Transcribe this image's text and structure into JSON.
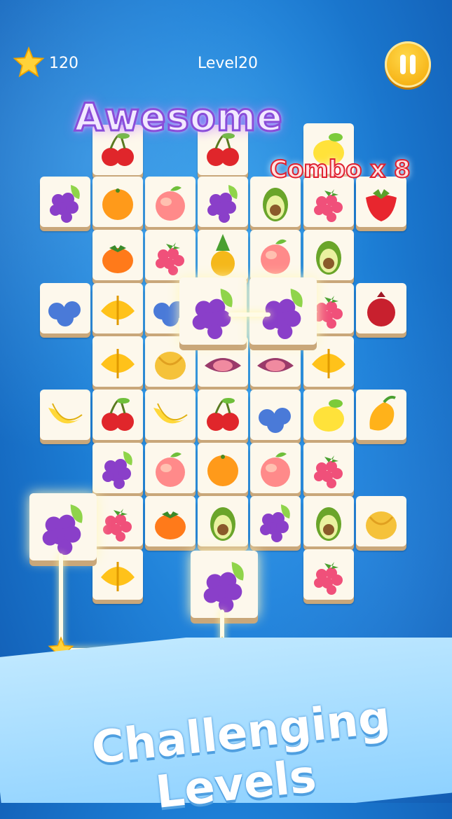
{
  "hud": {
    "stars": "120",
    "level": "Level20",
    "star_icon": "star-icon",
    "pause_icon": "pause-icon"
  },
  "effects": {
    "praise": "Awesome",
    "combo": "Combo x 8"
  },
  "banner": {
    "line1": "Challenging",
    "line2": "Levels"
  },
  "colors": {
    "accent": "#f3a400",
    "tile": "#fdf8ec",
    "tile_edge": "#c9a77a",
    "background": "#1d7fd6"
  },
  "board": {
    "tiles": [
      "cherries",
      "cherries",
      "lemon",
      "grapes",
      "orange",
      "peach",
      "grapes",
      "avocado",
      "raspberry",
      "strawberry",
      "persimmon",
      "raspberry",
      "pineapple",
      "peach",
      "avocado",
      "blueberries",
      "starfruit",
      "blueberries",
      "raspberry",
      "pomegranate",
      "starfruit",
      "melon",
      "fig",
      "fig",
      "starfruit",
      "banana",
      "cherries",
      "banana",
      "cherries",
      "blueberries",
      "lemon",
      "mango",
      "grapes",
      "peach",
      "orange",
      "peach",
      "raspberry",
      "raspberry",
      "persimmon",
      "avocado",
      "grapes",
      "avocado",
      "melon",
      "starfruit",
      "raspberry"
    ],
    "selected": [
      "grapes",
      "grapes"
    ],
    "matched_pair": [
      "grapes",
      "grapes"
    ]
  }
}
